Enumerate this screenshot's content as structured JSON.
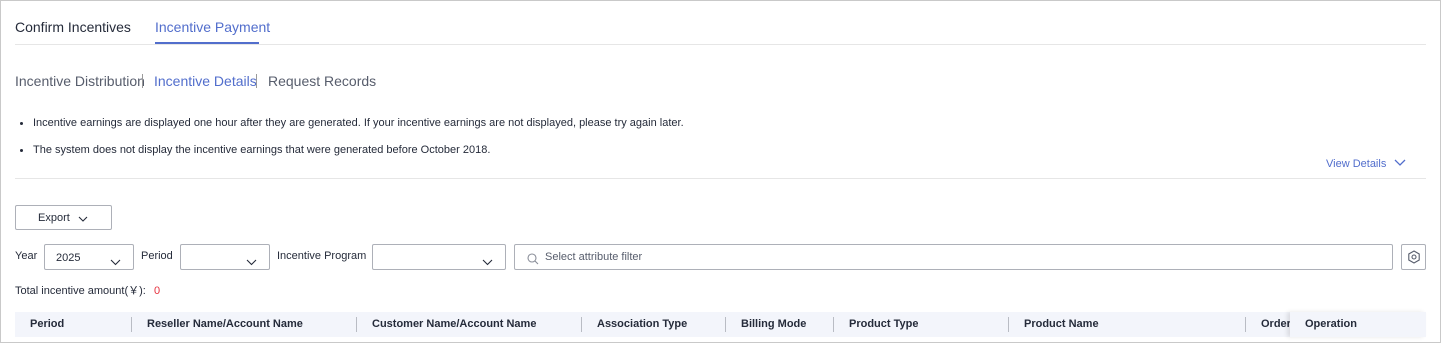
{
  "top_tabs": [
    {
      "label": "Confirm Incentives"
    },
    {
      "label": "Incentive Payment"
    }
  ],
  "sub_tabs": [
    {
      "label": "Incentive Distribution"
    },
    {
      "label": "Incentive Details"
    },
    {
      "label": "Request Records"
    }
  ],
  "notices": [
    "Incentive earnings are displayed one hour after they are generated. If your incentive earnings are not displayed, please try again later.",
    "The system does not display the incentive earnings that were generated before October 2018."
  ],
  "view_details_label": "View Details",
  "export_label": "Export",
  "filters": {
    "year_label": "Year",
    "year_value": "2025",
    "period_label": "Period",
    "period_value": "",
    "program_label": "Incentive Program",
    "program_value": "",
    "search_placeholder": "Select attribute filter"
  },
  "total": {
    "label": "Total incentive amount(￥):",
    "value": "0"
  },
  "table": {
    "columns": [
      "Period",
      "Reseller Name/Account Name",
      "Customer Name/Account Name",
      "Association Type",
      "Billing Mode",
      "Product Type",
      "Product Name",
      "Order",
      "Operation"
    ]
  },
  "colors": {
    "accent": "#526ecc",
    "text": "#252b3a",
    "amount": "#e6303d",
    "table_header_bg": "#f3f5fb"
  },
  "icons": {
    "view_details": "chevron-down-icon",
    "export": "chevron-down-icon",
    "search": "search-icon",
    "settings": "gear-icon"
  }
}
